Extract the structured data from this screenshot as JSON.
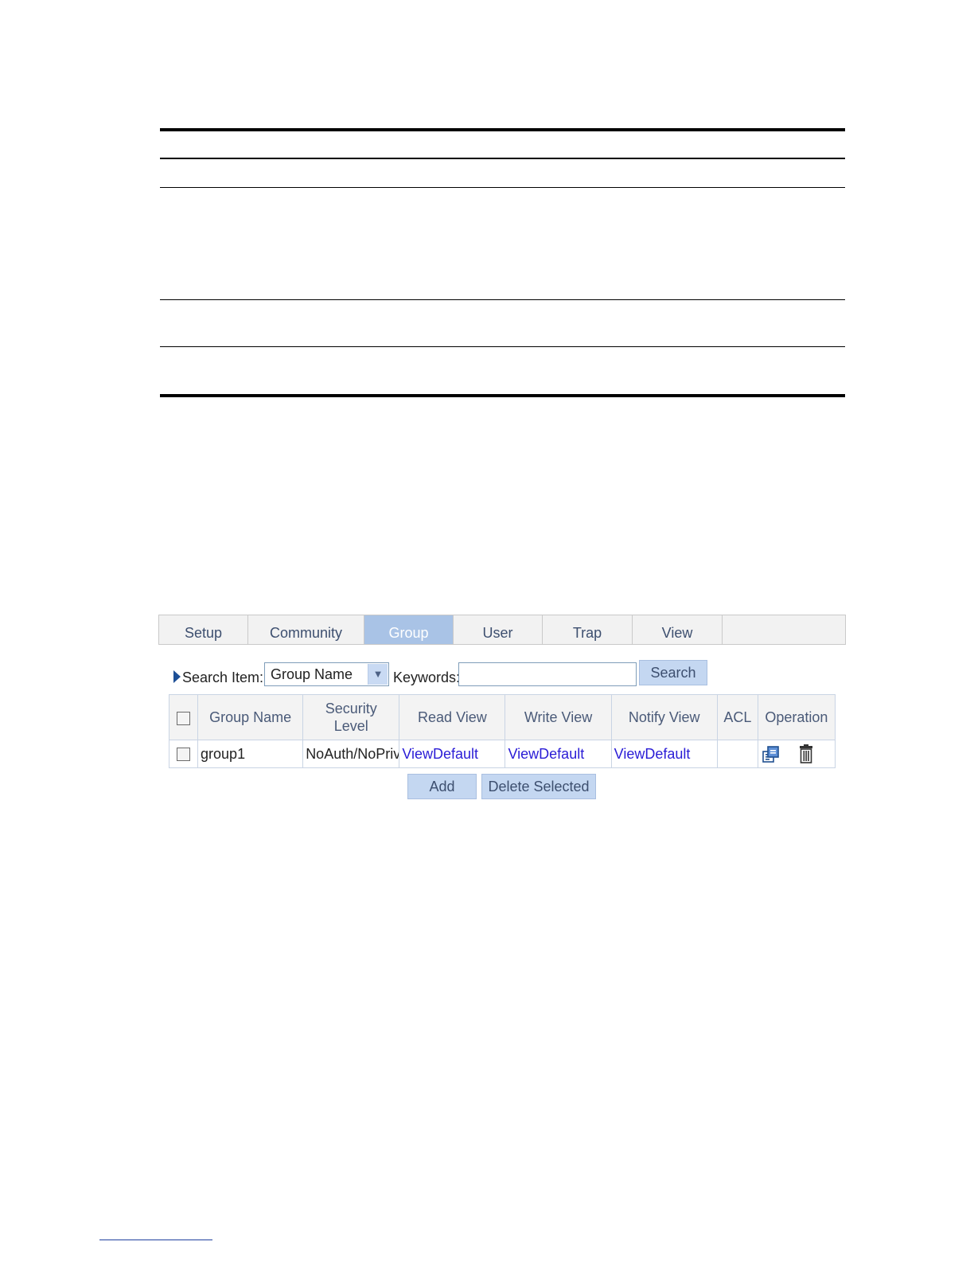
{
  "tabs": [
    {
      "label": "Setup",
      "active": false
    },
    {
      "label": "Community",
      "active": false
    },
    {
      "label": "Group",
      "active": true
    },
    {
      "label": "User",
      "active": false
    },
    {
      "label": "Trap",
      "active": false
    },
    {
      "label": "View",
      "active": false
    }
  ],
  "search": {
    "item_label": "Search Item:",
    "item_value": "Group Name",
    "keywords_label": "Keywords:",
    "keywords_value": "",
    "button_label": "Search"
  },
  "table": {
    "headers": {
      "group_name": "Group Name",
      "security_level_1": "Security",
      "security_level_2": "Level",
      "read_view": "Read View",
      "write_view": "Write View",
      "notify_view": "Notify View",
      "acl": "ACL",
      "operation": "Operation"
    },
    "rows": [
      {
        "group_name": "group1",
        "security_level": "NoAuth/NoPriv",
        "read_view": "ViewDefault",
        "write_view": "ViewDefault",
        "notify_view": "ViewDefault",
        "acl": ""
      }
    ]
  },
  "actions": {
    "add_label": "Add",
    "delete_label": "Delete Selected"
  },
  "icons": {
    "edit": "edit-icon",
    "delete": "trash-icon",
    "indicator": "triangle-right-icon"
  },
  "colors": {
    "active_tab": "#a9c3e6",
    "button": "#c4d7f1",
    "link": "#2a1cd6"
  }
}
